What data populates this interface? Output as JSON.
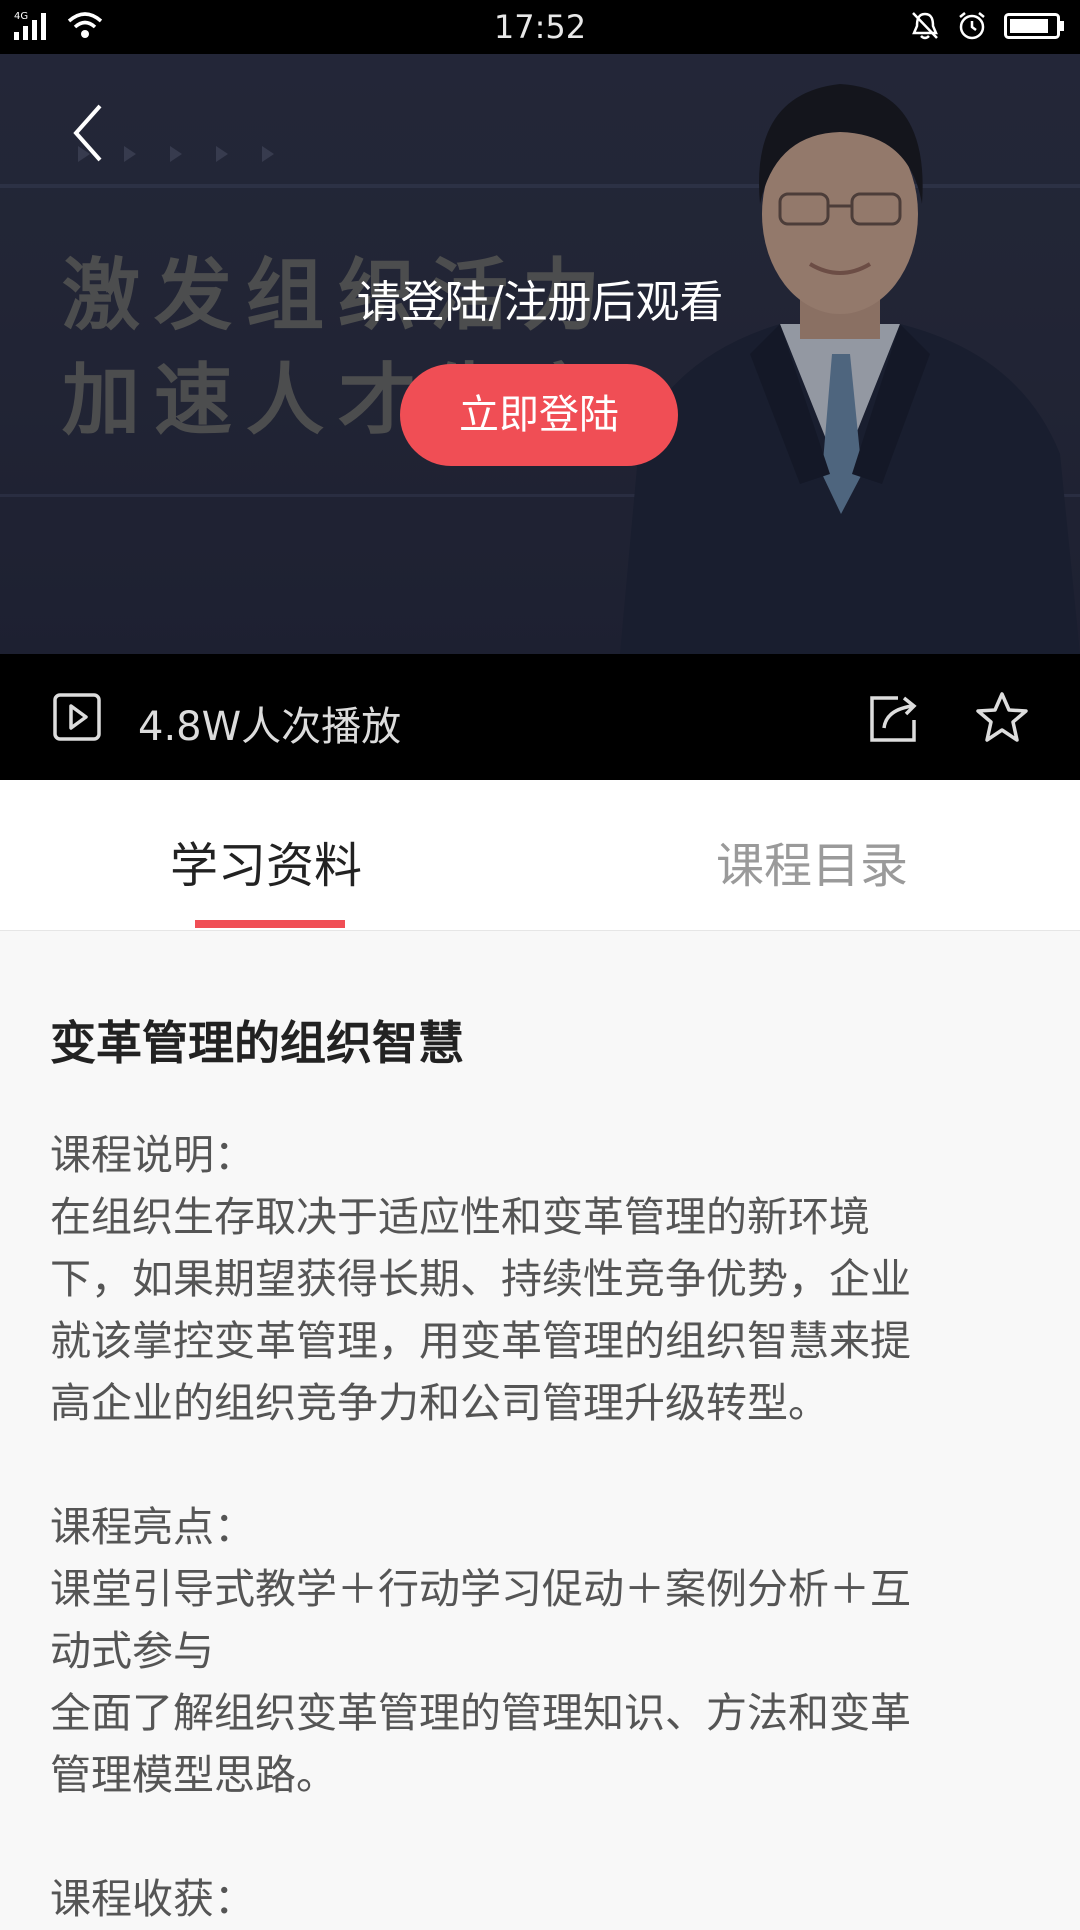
{
  "status_bar": {
    "network": "4G",
    "time": "17:52"
  },
  "player": {
    "banner_text": [
      "激发组织活力",
      "加速人才生产"
    ],
    "login_prompt": "请登陆/注册后观看",
    "login_button": "立即登陆",
    "play_count": "4.8W人次播放"
  },
  "tabs": [
    {
      "label": "学习资料",
      "active": true
    },
    {
      "label": "课程目录",
      "active": false
    }
  ],
  "course": {
    "title": "变革管理的组织智慧",
    "description_heading": "课程说明：",
    "description_lines": [
      "在组织生存取决于适应性和变革管理的新环境",
      "下，如果期望获得长期、持续性竞争优势，企业",
      "就该掌控变革管理，用变革管理的组织智慧来提",
      "高企业的组织竞争力和公司管理升级转型。"
    ],
    "highlights_heading": "课程亮点：",
    "highlights_lines": [
      "课堂引导式教学＋行动学习促动＋案例分析＋互",
      "动式参与",
      "全面了解组织变革管理的管理知识、方法和变革",
      "管理模型思路。"
    ],
    "gains_heading": "课程收获："
  },
  "colors": {
    "accent": "#f04e55",
    "status_bar_bg": "#000000",
    "info_bar_bg": "#000000"
  },
  "icons": [
    "signal-icon",
    "wifi-icon",
    "mute-bell-icon",
    "alarm-icon",
    "battery-icon",
    "back-arrow-icon",
    "play-square-icon",
    "share-icon",
    "star-icon"
  ]
}
